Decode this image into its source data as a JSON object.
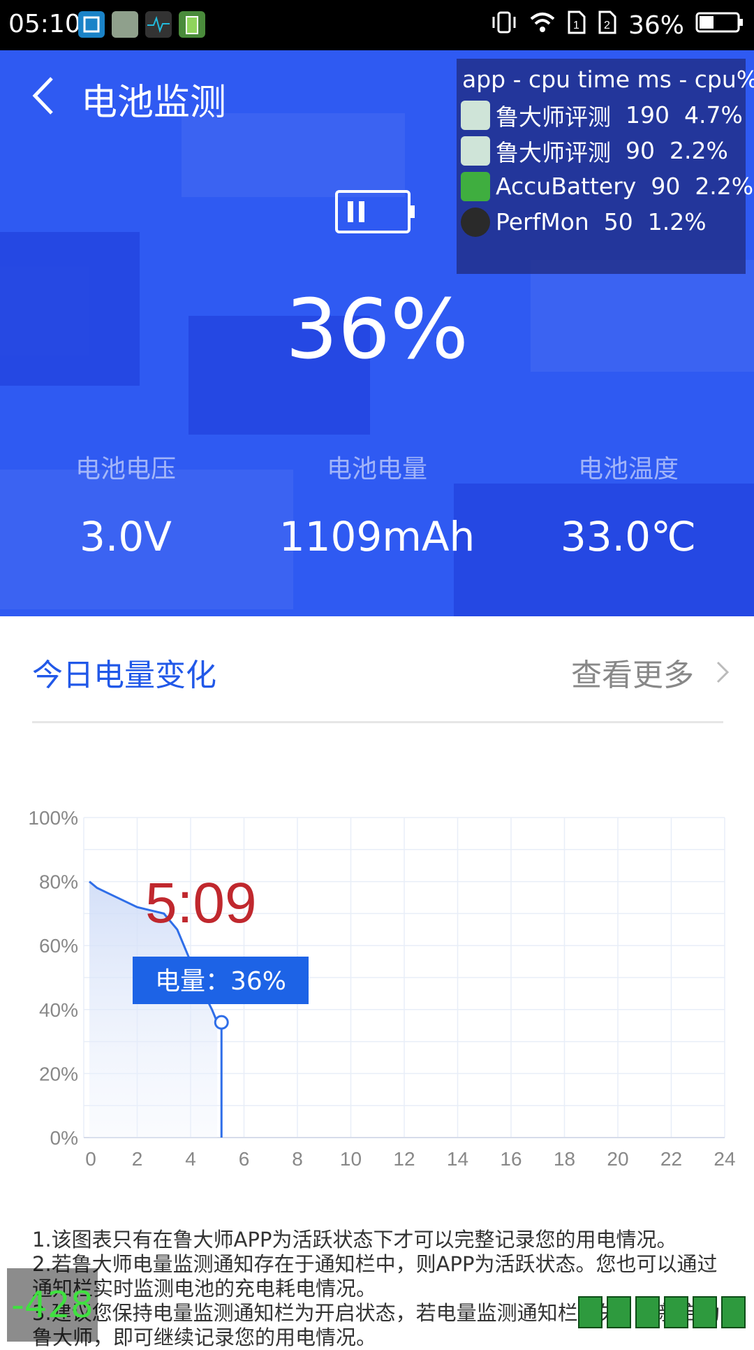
{
  "status_bar": {
    "time": "05:10",
    "battery_percent": "36%",
    "notification_icons": [
      "screenshot-icon",
      "lu-master-icon",
      "perfmon-icon",
      "accubattery-icon"
    ],
    "right_icons": [
      "vibrate-icon",
      "wifi-icon",
      "sim1-icon",
      "sim2-icon",
      "battery-icon"
    ]
  },
  "header": {
    "title": "电池监测",
    "back_icon": "chevron-left-icon"
  },
  "battery": {
    "percent": "36%",
    "level": 0.36,
    "icon": "battery-paused-icon"
  },
  "stats": [
    {
      "label": "电池电压",
      "value": "3.0V"
    },
    {
      "label": "电池电量",
      "value": "1109mAh"
    },
    {
      "label": "电池温度",
      "value": "33.0℃"
    }
  ],
  "overlay": {
    "header": "app - cpu time ms - cpu%",
    "rows": [
      {
        "app": "鲁大师评测",
        "time": "190",
        "cpu": "4.7%",
        "icon": "lu-master-icon"
      },
      {
        "app": "鲁大师评测",
        "time": "90",
        "cpu": "2.2%",
        "icon": "lu-master-icon"
      },
      {
        "app": "AccuBattery",
        "time": "90",
        "cpu": "2.2%",
        "icon": "accubattery-icon"
      },
      {
        "app": "PerfMon",
        "time": "50",
        "cpu": "1.2%",
        "icon": "perfmon-icon"
      }
    ]
  },
  "section": {
    "title": "今日电量变化",
    "more": "查看更多"
  },
  "chart_data": {
    "type": "area",
    "x": [
      0,
      0.5,
      1,
      1.5,
      2,
      2.5,
      3,
      3.5,
      4,
      4.5,
      4.8,
      5
    ],
    "values": [
      80,
      78,
      76,
      74,
      72,
      71,
      70,
      65,
      55,
      45,
      40,
      36
    ],
    "xticks": [
      "0",
      "2",
      "4",
      "6",
      "8",
      "10",
      "12",
      "14",
      "16",
      "18",
      "20",
      "22",
      "24"
    ],
    "yticks": [
      "0%",
      "20%",
      "40%",
      "60%",
      "80%",
      "100%"
    ],
    "xlim": [
      0,
      24
    ],
    "ylim": [
      0,
      100
    ],
    "grid": true,
    "annotation": {
      "time": "5:09",
      "label": "电量：36%",
      "x": 5,
      "y": 36
    },
    "color": "#2f6ee8"
  },
  "notes": [
    "1.该图表只有在鲁大师APP为活跃状态下才可以完整记录您的用电情况。",
    "2.若鲁大师电量监测通知存在于通知栏中，则APP为活跃状态。您也可以通过通知栏实时监测电池的充电耗电情况。",
    "3.建议您保持电量监测通知栏为开启状态，若电量监测通知栏消失，重新启动鲁大师，即可继续记录您的用电情况。"
  ],
  "fps_counter": "-428",
  "colors": {
    "hero": "#2f5af2",
    "accent": "#2158e8",
    "annotation_time": "#c0282e",
    "tooltip": "#1d63e6"
  }
}
